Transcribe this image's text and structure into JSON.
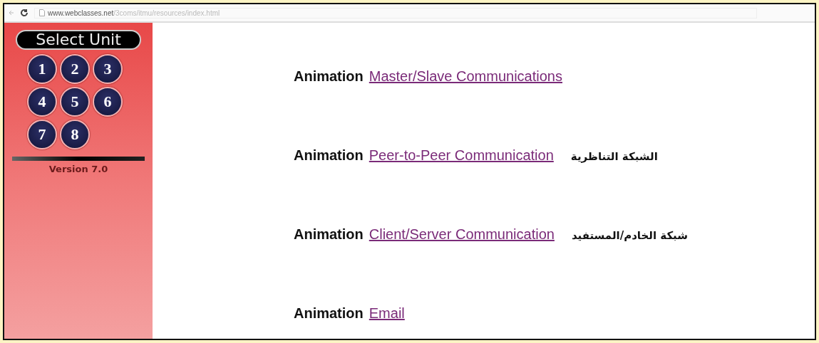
{
  "browser": {
    "url_host": "www.webclasses.net",
    "url_path": "/3coms/itmu/resources/index.html"
  },
  "sidebar": {
    "title": "Select Unit",
    "units": [
      "1",
      "2",
      "3",
      "4",
      "5",
      "6",
      "7",
      "8"
    ],
    "version": "Version 7.0"
  },
  "items": [
    {
      "label": "Animation",
      "link": "Master/Slave Communications"
    },
    {
      "label": "Animation",
      "link": "Peer-to-Peer Communication",
      "arabic": "الشبكة التناظرية"
    },
    {
      "label": "Animation",
      "link": "Client/Server Communication",
      "arabic": "شبكة الخادم/المستفيد"
    },
    {
      "label": "Animation",
      "link": "Email"
    }
  ]
}
